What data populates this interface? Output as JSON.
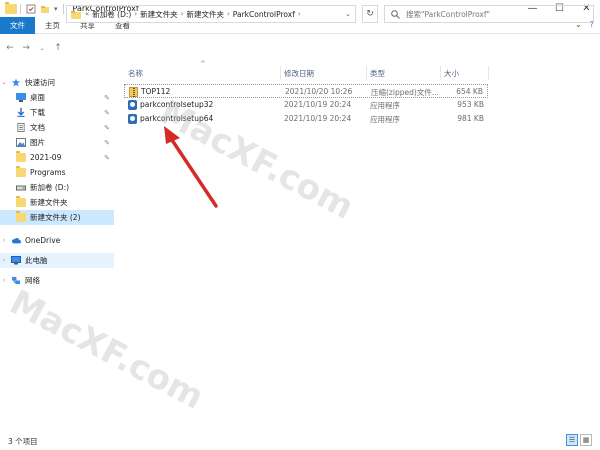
{
  "window": {
    "title": "ParkControlProxf",
    "minimize": "—",
    "maximize": "☐",
    "close": "✕"
  },
  "ribbon": {
    "tabs": [
      {
        "label": "文件",
        "active": true
      },
      {
        "label": "主页",
        "active": false
      },
      {
        "label": "共享",
        "active": false
      },
      {
        "label": "查看",
        "active": false
      }
    ]
  },
  "address": {
    "overflow": "«",
    "crumbs": [
      "新加卷 (D:)",
      "新建文件夹",
      "新建文件夹",
      "ParkControlProxf"
    ],
    "search_placeholder": "搜索\"ParkControlProxf\""
  },
  "nav": {
    "quick_access": "快速访问",
    "items": [
      {
        "label": "桌面",
        "icon": "desktop-icon",
        "pinned": true
      },
      {
        "label": "下载",
        "icon": "download-icon",
        "pinned": true
      },
      {
        "label": "文档",
        "icon": "document-icon",
        "pinned": true
      },
      {
        "label": "图片",
        "icon": "picture-icon",
        "pinned": true
      },
      {
        "label": "2021-09",
        "icon": "folder-icon",
        "pinned": true
      },
      {
        "label": "Programs",
        "icon": "folder-icon",
        "pinned": false
      },
      {
        "label": "新加卷 (D:)",
        "icon": "drive-icon",
        "pinned": false
      },
      {
        "label": "新建文件夹",
        "icon": "folder-icon",
        "pinned": false
      },
      {
        "label": "新建文件夹 (2)",
        "icon": "folder-icon",
        "pinned": false
      }
    ],
    "onedrive": "OneDrive",
    "this_pc": "此电脑",
    "network": "网络"
  },
  "columns": {
    "name": "名称",
    "date": "修改日期",
    "type": "类型",
    "size": "大小"
  },
  "files": [
    {
      "name": "TOP112",
      "date": "2021/10/20 10:26",
      "type": "压缩(zipped)文件...",
      "size": "654 KB",
      "icon": "zip-icon"
    },
    {
      "name": "parkcontrolsetup32",
      "date": "2021/10/19 20:24",
      "type": "应用程序",
      "size": "953 KB",
      "icon": "exe-icon"
    },
    {
      "name": "parkcontrolsetup64",
      "date": "2021/10/19 20:24",
      "type": "应用程序",
      "size": "981 KB",
      "icon": "exe-icon"
    }
  ],
  "status": {
    "count": "3 个项目"
  },
  "watermark": "MacXF.com",
  "colors": {
    "accent": "#1979ca",
    "selected": "#cce8ff",
    "arrow": "#d42a2a"
  }
}
